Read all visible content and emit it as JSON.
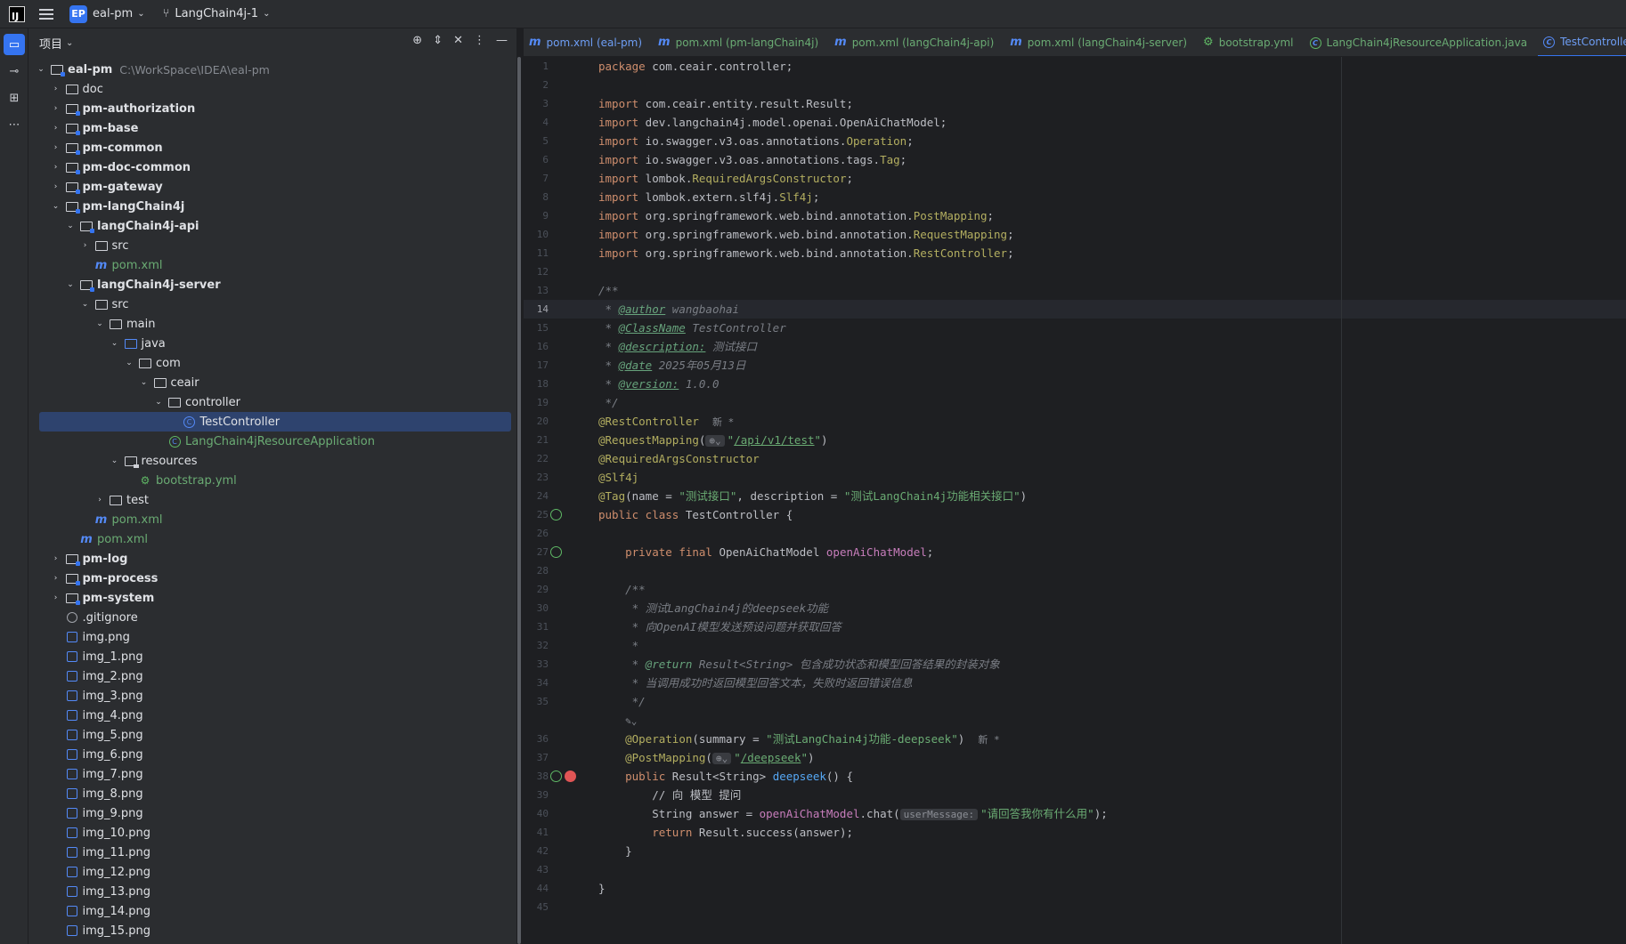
{
  "titlebar": {
    "logo": "IJ",
    "project_badge": "EP",
    "project_name": "eal-pm",
    "branch": "LangChain4j-1"
  },
  "project_panel": {
    "title": "项目",
    "tree": [
      {
        "depth": 0,
        "arrow": "down",
        "icon": "module",
        "label": "eal-pm",
        "bold": true,
        "hint": "C:\\WorkSpace\\IDEA\\eal-pm"
      },
      {
        "depth": 1,
        "arrow": "right",
        "icon": "folder",
        "label": "doc"
      },
      {
        "depth": 1,
        "arrow": "right",
        "icon": "module",
        "label": "pm-authorization",
        "bold": true
      },
      {
        "depth": 1,
        "arrow": "right",
        "icon": "module",
        "label": "pm-base",
        "bold": true
      },
      {
        "depth": 1,
        "arrow": "right",
        "icon": "module",
        "label": "pm-common",
        "bold": true
      },
      {
        "depth": 1,
        "arrow": "right",
        "icon": "module",
        "label": "pm-doc-common",
        "bold": true
      },
      {
        "depth": 1,
        "arrow": "right",
        "icon": "module",
        "label": "pm-gateway",
        "bold": true
      },
      {
        "depth": 1,
        "arrow": "down",
        "icon": "module",
        "label": "pm-langChain4j",
        "bold": true
      },
      {
        "depth": 2,
        "arrow": "down",
        "icon": "module",
        "label": "langChain4j-api",
        "bold": true
      },
      {
        "depth": 3,
        "arrow": "right",
        "icon": "folder",
        "label": "src"
      },
      {
        "depth": 3,
        "arrow": "",
        "icon": "maven",
        "label": "pom.xml",
        "green": true
      },
      {
        "depth": 2,
        "arrow": "down",
        "icon": "module",
        "label": "langChain4j-server",
        "bold": true
      },
      {
        "depth": 3,
        "arrow": "down",
        "icon": "folder",
        "label": "src"
      },
      {
        "depth": 4,
        "arrow": "down",
        "icon": "folder",
        "label": "main"
      },
      {
        "depth": 5,
        "arrow": "down",
        "icon": "folder-blue",
        "label": "java"
      },
      {
        "depth": 6,
        "arrow": "down",
        "icon": "package",
        "label": "com"
      },
      {
        "depth": 7,
        "arrow": "down",
        "icon": "package",
        "label": "ceair"
      },
      {
        "depth": 8,
        "arrow": "down",
        "icon": "package",
        "label": "controller"
      },
      {
        "depth": 9,
        "arrow": "",
        "icon": "class",
        "label": "TestController",
        "selected": true
      },
      {
        "depth": 8,
        "arrow": "",
        "icon": "spring-class",
        "label": "LangChain4jResourceApplication",
        "green": true
      },
      {
        "depth": 5,
        "arrow": "down",
        "icon": "resources",
        "label": "resources"
      },
      {
        "depth": 6,
        "arrow": "",
        "icon": "yml",
        "label": "bootstrap.yml",
        "green": true
      },
      {
        "depth": 4,
        "arrow": "right",
        "icon": "folder",
        "label": "test"
      },
      {
        "depth": 3,
        "arrow": "",
        "icon": "maven",
        "label": "pom.xml",
        "green": true
      },
      {
        "depth": 2,
        "arrow": "",
        "icon": "maven",
        "label": "pom.xml",
        "green": true
      },
      {
        "depth": 1,
        "arrow": "right",
        "icon": "module",
        "label": "pm-log",
        "bold": true
      },
      {
        "depth": 1,
        "arrow": "right",
        "icon": "module",
        "label": "pm-process",
        "bold": true
      },
      {
        "depth": 1,
        "arrow": "right",
        "icon": "module",
        "label": "pm-system",
        "bold": true
      },
      {
        "depth": 1,
        "arrow": "",
        "icon": "ignore",
        "label": ".gitignore"
      },
      {
        "depth": 1,
        "arrow": "",
        "icon": "png",
        "label": "img.png"
      },
      {
        "depth": 1,
        "arrow": "",
        "icon": "png",
        "label": "img_1.png"
      },
      {
        "depth": 1,
        "arrow": "",
        "icon": "png",
        "label": "img_2.png"
      },
      {
        "depth": 1,
        "arrow": "",
        "icon": "png",
        "label": "img_3.png"
      },
      {
        "depth": 1,
        "arrow": "",
        "icon": "png",
        "label": "img_4.png"
      },
      {
        "depth": 1,
        "arrow": "",
        "icon": "png",
        "label": "img_5.png"
      },
      {
        "depth": 1,
        "arrow": "",
        "icon": "png",
        "label": "img_6.png"
      },
      {
        "depth": 1,
        "arrow": "",
        "icon": "png",
        "label": "img_7.png"
      },
      {
        "depth": 1,
        "arrow": "",
        "icon": "png",
        "label": "img_8.png"
      },
      {
        "depth": 1,
        "arrow": "",
        "icon": "png",
        "label": "img_9.png"
      },
      {
        "depth": 1,
        "arrow": "",
        "icon": "png",
        "label": "img_10.png"
      },
      {
        "depth": 1,
        "arrow": "",
        "icon": "png",
        "label": "img_11.png"
      },
      {
        "depth": 1,
        "arrow": "",
        "icon": "png",
        "label": "img_12.png"
      },
      {
        "depth": 1,
        "arrow": "",
        "icon": "png",
        "label": "img_13.png"
      },
      {
        "depth": 1,
        "arrow": "",
        "icon": "png",
        "label": "img_14.png"
      },
      {
        "depth": 1,
        "arrow": "",
        "icon": "png",
        "label": "img_15.png"
      }
    ]
  },
  "tabs": [
    {
      "label": "pom.xml (eal-pm)",
      "icon": "maven",
      "color": "blue"
    },
    {
      "label": "pom.xml (pm-langChain4j)",
      "icon": "maven",
      "color": "green"
    },
    {
      "label": "pom.xml (langChain4j-api)",
      "icon": "maven",
      "color": "green"
    },
    {
      "label": "pom.xml (langChain4j-server)",
      "icon": "maven",
      "color": "green"
    },
    {
      "label": "bootstrap.yml",
      "icon": "yml",
      "color": "green"
    },
    {
      "label": "LangChain4jResourceApplication.java",
      "icon": "spring-class",
      "color": "green"
    },
    {
      "label": "TestController.java",
      "icon": "class",
      "color": "blue",
      "active": true
    }
  ],
  "editor": {
    "current_line": 14,
    "lines": [
      {
        "n": "1",
        "html": "<span class='kw'>package</span> com.ceair.controller;"
      },
      {
        "n": "2",
        "html": ""
      },
      {
        "n": "3",
        "html": "<span class='kw'>import</span> com.ceair.entity.result.Result;"
      },
      {
        "n": "4",
        "html": "<span class='kw'>import</span> dev.langchain4j.model.openai.OpenAiChatModel;"
      },
      {
        "n": "5",
        "html": "<span class='kw'>import</span> io.swagger.v3.oas.annotations.<span class='ann'>Operation</span>;"
      },
      {
        "n": "6",
        "html": "<span class='kw'>import</span> io.swagger.v3.oas.annotations.tags.<span class='ann'>Tag</span>;"
      },
      {
        "n": "7",
        "html": "<span class='kw'>import</span> lombok.<span class='ann'>RequiredArgsConstructor</span>;"
      },
      {
        "n": "8",
        "html": "<span class='kw'>import</span> lombok.extern.slf4j.<span class='ann'>Slf4j</span>;"
      },
      {
        "n": "9",
        "html": "<span class='kw'>import</span> org.springframework.web.bind.annotation.<span class='ann'>PostMapping</span>;"
      },
      {
        "n": "10",
        "html": "<span class='kw'>import</span> org.springframework.web.bind.annotation.<span class='ann'>RequestMapping</span>;"
      },
      {
        "n": "11",
        "html": "<span class='kw'>import</span> org.springframework.web.bind.annotation.<span class='ann'>RestController</span>;"
      },
      {
        "n": "12",
        "html": ""
      },
      {
        "n": "13",
        "html": "<span class='cmt'>/**</span>"
      },
      {
        "n": "14",
        "html": "<span class='cmt'> * </span><span class='doctag'>@author</span><span class='cmt'> wangbaohai</span>"
      },
      {
        "n": "15",
        "html": "<span class='cmt'> * </span><span class='doctag'>@ClassName</span><span class='cmt'> TestController</span>"
      },
      {
        "n": "16",
        "html": "<span class='cmt'> * </span><span class='doctag'>@description:</span><span class='cmt'> 测试接口</span>"
      },
      {
        "n": "17",
        "html": "<span class='cmt'> * </span><span class='doctag'>@date</span><span class='cmt'> 2025年05月13日</span>"
      },
      {
        "n": "18",
        "html": "<span class='cmt'> * </span><span class='doctag'>@version:</span><span class='cmt'> 1.0.0</span>"
      },
      {
        "n": "19",
        "html": "<span class='cmt'> */</span>"
      },
      {
        "n": "20",
        "html": "<span class='ann'>@RestController</span>  <span class='newhint'>新 *</span>"
      },
      {
        "n": "21",
        "html": "<span class='ann'>@RequestMapping</span>(<span class='hint'>⊕⌄</span><span class='str'>\"</span><span class='ilgreen'>/api/v1/test</span><span class='str'>\"</span>)"
      },
      {
        "n": "22",
        "html": "<span class='ann'>@RequiredArgsConstructor</span>"
      },
      {
        "n": "23",
        "html": "<span class='ann'>@Slf4j</span>"
      },
      {
        "n": "24",
        "html": "<span class='ann'>@Tag</span>(name = <span class='str'>\"测试接口\"</span>, description = <span class='str'>\"测试LangChain4j功能相关接口\"</span>)"
      },
      {
        "n": "25",
        "html": "<span class='kw'>public class</span> TestController {",
        "gmark": true
      },
      {
        "n": "26",
        "html": ""
      },
      {
        "n": "27",
        "html": "    <span class='kw'>private final</span> OpenAiChatModel <span class='fld'>openAiChatModel</span>;",
        "gmark": true
      },
      {
        "n": "28",
        "html": ""
      },
      {
        "n": "29",
        "html": "    <span class='cmt'>/**</span>"
      },
      {
        "n": "30",
        "html": "<span class='cmt'>     * 测试LangChain4j的deepseek功能</span>"
      },
      {
        "n": "31",
        "html": "<span class='cmt'>     * 向OpenAI模型发送预设问题并获取回答</span>"
      },
      {
        "n": "32",
        "html": "<span class='cmt'>     *</span>"
      },
      {
        "n": "33",
        "html": "<span class='cmt'>     * </span><span class='doctag' style='text-decoration:none'>@return</span><span class='cmt'> Result&lt;String&gt; 包含成功状态和模型回答结果的封装对象</span>"
      },
      {
        "n": "34",
        "html": "<span class='cmt'>     * 当调用成功时返回模型回答文本，失败时返回错误信息</span>"
      },
      {
        "n": "35",
        "html": "<span class='cmt'>     */</span>"
      },
      {
        "n": "",
        "html": "    <span class='newhint'>✎⌄</span>"
      },
      {
        "n": "36",
        "html": "    <span class='ann'>@Operation</span>(summary = <span class='str'>\"测试LangChain4j功能-deepseek\"</span>)  <span class='newhint'>新 *</span>"
      },
      {
        "n": "37",
        "html": "    <span class='ann'>@PostMapping</span>(<span class='hint'>⊕⌄</span><span class='str'>\"</span><span class='ilgreen'>/deepseek</span><span class='str'>\"</span>)"
      },
      {
        "n": "38",
        "html": "    <span class='kw'>public</span> Result&lt;String&gt; <span class='fn'>deepseek</span>() {",
        "gmark": true,
        "gmark2": true
      },
      {
        "n": "39",
        "html": "        <span class='cmt' style='font-style:normal;color:#bcbec4'>// 向 模型 提问</span>"
      },
      {
        "n": "40",
        "html": "        String answer = <span class='fld'>openAiChatModel</span>.chat(<span class='hint'>userMessage:</span><span class='str'>\"请回答我你有什么用\"</span>);"
      },
      {
        "n": "41",
        "html": "        <span class='kw'>return</span> Result.success(answer);"
      },
      {
        "n": "42",
        "html": "    }"
      },
      {
        "n": "43",
        "html": ""
      },
      {
        "n": "44",
        "html": "}"
      },
      {
        "n": "45",
        "html": ""
      }
    ]
  }
}
